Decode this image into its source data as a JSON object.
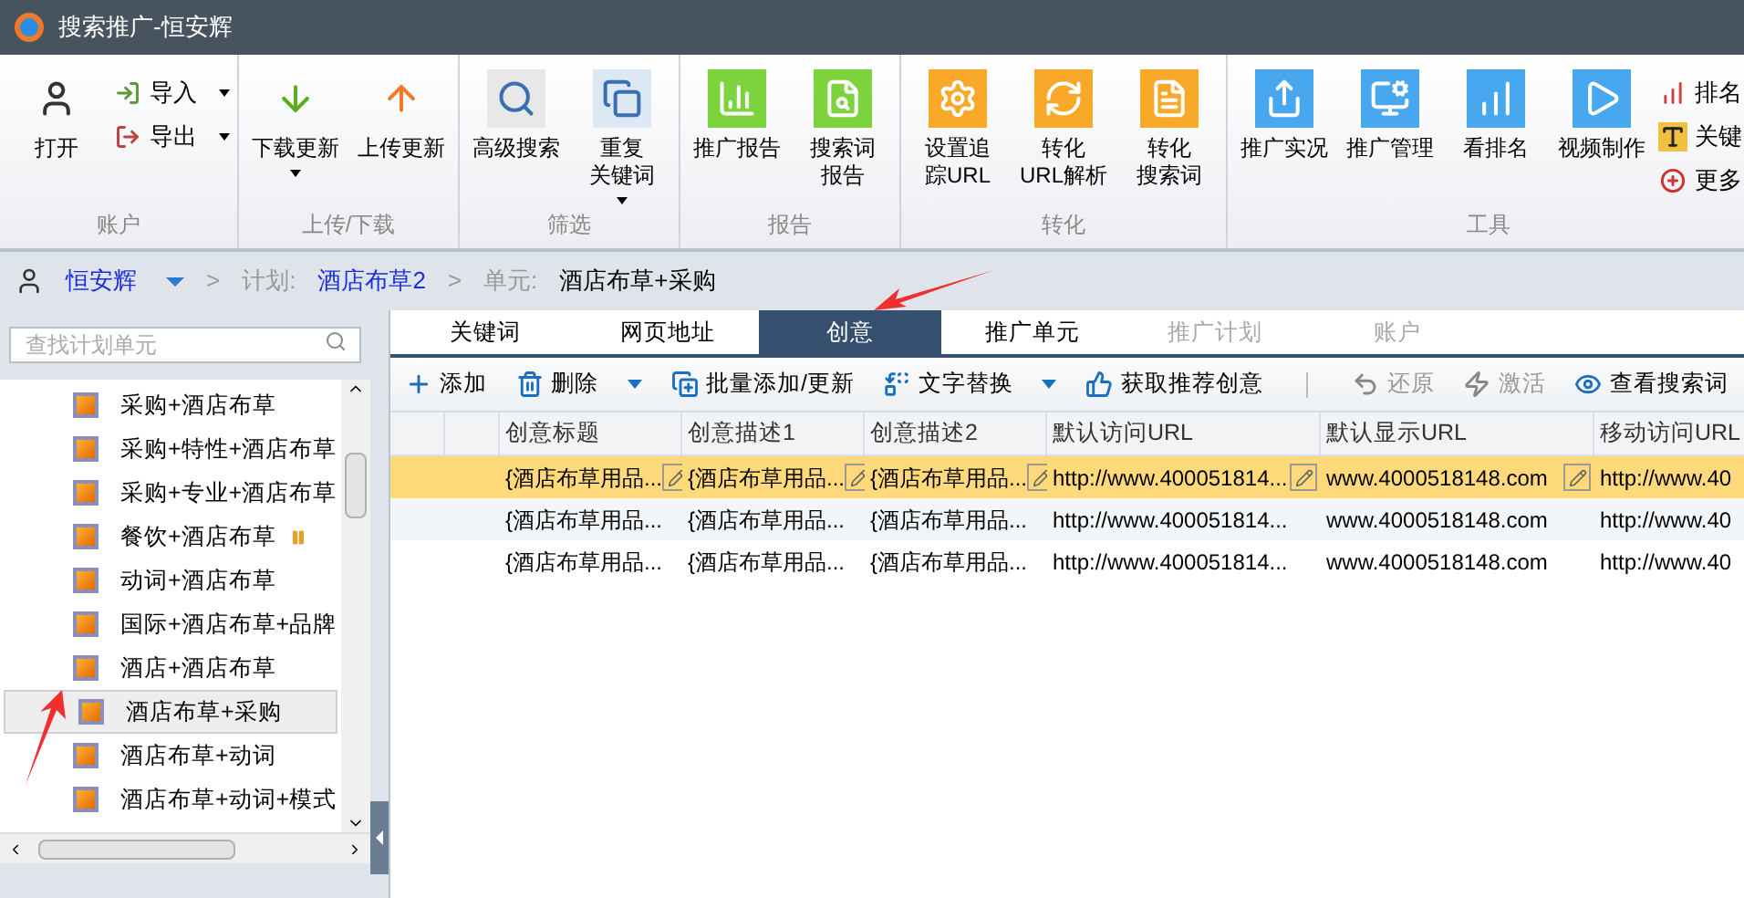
{
  "window": {
    "title": "搜索推广-恒安辉"
  },
  "ribbon": {
    "groups": [
      {
        "label": "账户",
        "items": [
          {
            "kind": "big",
            "label": "打开",
            "dropdown": false
          },
          {
            "kind": "small",
            "label": "导入",
            "dropdown": true
          },
          {
            "kind": "small",
            "label": "导出",
            "dropdown": true
          }
        ]
      },
      {
        "label": "上传/下载",
        "items": [
          {
            "kind": "big",
            "label": "下载更新",
            "dropdown": true
          },
          {
            "kind": "big",
            "label": "上传更新",
            "dropdown": false
          }
        ]
      },
      {
        "label": "筛选",
        "items": [
          {
            "kind": "big",
            "label": "高级搜索",
            "dropdown": false
          },
          {
            "kind": "big",
            "label": "重复关键词",
            "dropdown": true
          }
        ]
      },
      {
        "label": "报告",
        "items": [
          {
            "kind": "big",
            "label": "推广报告",
            "dropdown": false
          },
          {
            "kind": "big",
            "label": "搜索词报告",
            "dropdown": false
          }
        ]
      },
      {
        "label": "转化",
        "items": [
          {
            "kind": "big",
            "label": "设置追踪URL",
            "dropdown": false
          },
          {
            "kind": "big",
            "label": "转化URL解析",
            "dropdown": false
          },
          {
            "kind": "big",
            "label": "转化搜索词",
            "dropdown": false
          }
        ]
      },
      {
        "label": "工具",
        "items": [
          {
            "kind": "big",
            "label": "推广实况",
            "dropdown": false
          },
          {
            "kind": "big",
            "label": "推广管理",
            "dropdown": false
          },
          {
            "kind": "big",
            "label": "看排名",
            "dropdown": false
          },
          {
            "kind": "big",
            "label": "视频制作",
            "dropdown": false
          },
          {
            "kind": "small",
            "label": "排名",
            "dropdown": false
          },
          {
            "kind": "small",
            "label": "关键",
            "dropdown": false
          },
          {
            "kind": "small",
            "label": "更多",
            "dropdown": false
          }
        ]
      }
    ]
  },
  "breadcrumb": {
    "account": "恒安辉",
    "separator_1": ">",
    "plan_label": "计划:",
    "plan": "酒店布草2",
    "separator_2": ">",
    "unit_label": "单元:",
    "unit": "酒店布草+采购"
  },
  "sidebar": {
    "search": {
      "placeholder": "查找计划单元"
    },
    "items": [
      {
        "label": "采购+酒店布草",
        "selected": false,
        "paused": false
      },
      {
        "label": "采购+特性+酒店布草",
        "selected": false,
        "paused": false
      },
      {
        "label": "采购+专业+酒店布草",
        "selected": false,
        "paused": false
      },
      {
        "label": "餐饮+酒店布草",
        "selected": false,
        "paused": true
      },
      {
        "label": "动词+酒店布草",
        "selected": false,
        "paused": false
      },
      {
        "label": "国际+酒店布草+品牌",
        "selected": false,
        "paused": false
      },
      {
        "label": "酒店+酒店布草",
        "selected": false,
        "paused": false
      },
      {
        "label": "酒店布草+采购",
        "selected": true,
        "paused": false
      },
      {
        "label": "酒店布草+动词",
        "selected": false,
        "paused": false
      },
      {
        "label": "酒店布草+动词+模式",
        "selected": false,
        "paused": false
      }
    ]
  },
  "tabs": [
    {
      "label": "关键词",
      "selected": false,
      "disabled": false
    },
    {
      "label": "网页地址",
      "selected": false,
      "disabled": false
    },
    {
      "label": "创意",
      "selected": true,
      "disabled": false
    },
    {
      "label": "推广单元",
      "selected": false,
      "disabled": false
    },
    {
      "label": "推广计划",
      "selected": false,
      "disabled": true
    },
    {
      "label": "账户",
      "selected": false,
      "disabled": true
    }
  ],
  "toolbar": [
    {
      "label": "添加",
      "dropdown": false,
      "disabled": false
    },
    {
      "label": "删除",
      "dropdown": true,
      "disabled": false
    },
    {
      "label": "批量添加/更新",
      "dropdown": false,
      "disabled": false
    },
    {
      "label": "文字替换",
      "dropdown": true,
      "disabled": false
    },
    {
      "label": "获取推荐创意",
      "dropdown": false,
      "disabled": false
    },
    {
      "label": "还原",
      "dropdown": false,
      "disabled": true
    },
    {
      "label": "激活",
      "dropdown": false,
      "disabled": true
    },
    {
      "label": "查看搜索词",
      "dropdown": false,
      "disabled": false
    }
  ],
  "table": {
    "columns": [
      "创意标题",
      "创意描述1",
      "创意描述2",
      "默认访问URL",
      "默认显示URL",
      "移动访问URL"
    ],
    "rows": [
      {
        "selected": true,
        "cells": [
          "{酒店布草用品...",
          "{酒店布草用品...",
          "{酒店布草用品...",
          "http://www.400051814...",
          "www.4000518148.com",
          "http://www.40"
        ]
      },
      {
        "selected": false,
        "cells": [
          "{酒店布草用品...",
          "{酒店布草用品...",
          "{酒店布草用品...",
          "http://www.400051814...",
          "www.4000518148.com",
          "http://www.40"
        ]
      },
      {
        "selected": false,
        "cells": [
          "{酒店布草用品...",
          "{酒店布草用品...",
          "{酒店布草用品...",
          "http://www.400051814...",
          "www.4000518148.com",
          "http://www.40"
        ]
      }
    ]
  }
}
